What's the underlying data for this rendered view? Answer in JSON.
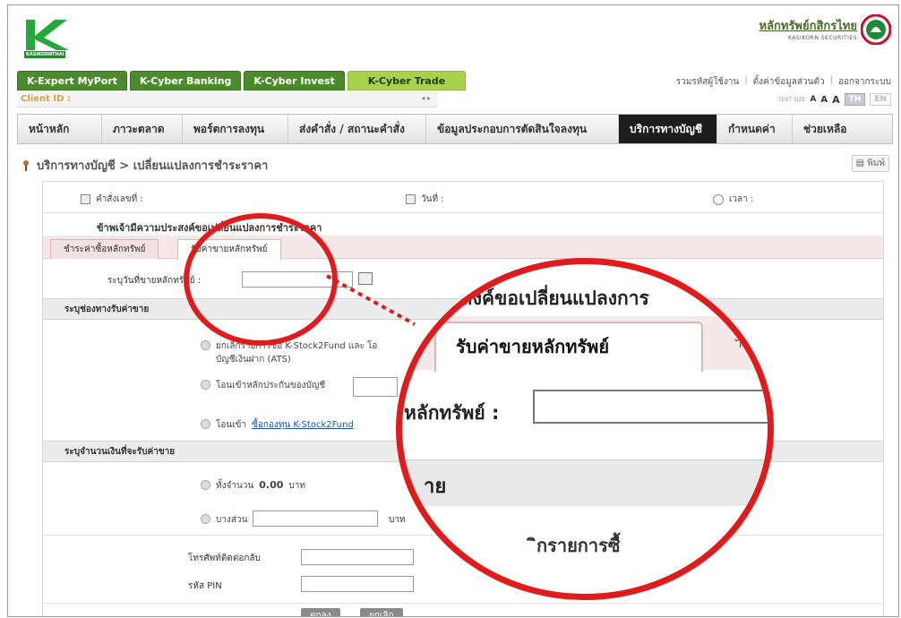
{
  "header": {
    "logo_text": "KASIKORNTHAI",
    "brand_main": "หลักทรัพย์กสิกรไทย",
    "brand_sub": "KASIKORN SECURITIES"
  },
  "top_tabs": [
    "K-Expert MyPort",
    "K-Cyber Banking",
    "K-Cyber Invest",
    "K-Cyber Trade"
  ],
  "user_links": [
    "รวมรหัสผู้ใช้งาน",
    "ตั้งค่าข้อมูลส่วนตัว",
    "ออกจากระบบ"
  ],
  "client": {
    "label": "Client ID :",
    "arrows": "◂ ▸"
  },
  "text_size": {
    "label": "TEXT SIZE",
    "a1": "A",
    "a2": "A",
    "a3": "A",
    "lang_th": "TH",
    "lang_en": "EN"
  },
  "main_nav": [
    "หน้าหลัก",
    "ภาวะตลาด",
    "พอร์ตการลงทุน",
    "ส่งคำสั่ง / สถานะคำสั่ง",
    "ข้อมูลประกอบการตัดสินใจลงทุน",
    "บริการทางบัญชี",
    "กำหนดค่า",
    "ช่วยเหลือ"
  ],
  "breadcrumb": "บริการทางบัญชี > เปลี่ยนแปลงการชำระราคา",
  "print_label": "พิมพ์",
  "form": {
    "order_no_label": "คำสั่งเลขที่ :",
    "date_label": "วันที่ :",
    "time_label": "เวลา :",
    "intent": "ข้าพเจ้ามีความประสงค์ขอเปลี่ยนแปลงการชำระราคา",
    "tab_buy": "ชำระค่าซื้อหลักทรัพย์",
    "tab_sell": "รับค่าขายหลักทรัพย์",
    "sell_date_label": "ระบุวันที่ขายหลักทรัพย์ :",
    "section_channel": "ระบุช่องทางรับค่าขาย",
    "option1_line1": "ยกเลิกรายการซื้อ K-Stock2Fund และ โอ",
    "option1_line2": "บัญชีเงินฝาก (ATS)",
    "option1_tail": "ัก",
    "option2": "โอนเข้าหลักประกันของบัญชี",
    "option3_prefix": "โอนเข้า",
    "option3_link": "ซื้อกองทุน K-Stock2Fund",
    "section_amount": "ระบุจำนวนเงินที่จะรับค่าขาย",
    "amount_full": "ทั้งจำนวน",
    "amount_value": "0.00",
    "baht": "บาท",
    "amount_partial": "บางส่วน",
    "phone_label": "โทรศัพท์ติดต่อกลับ",
    "pin_label": "รหัส PIN",
    "ok": "ตกลง",
    "cancel": "ยกเลิก"
  },
  "zoom": {
    "intent": "ประสงค์ขอเปลี่ยนแปลงการ",
    "tab_label": "รับค่าขายหลักทรัพย์",
    "after_tab": "ัก",
    "field_label": "หลักทรัพย์ :",
    "section": "าย",
    "below": "ิกรายการซื้"
  },
  "colors": {
    "accent_red": "#e01b1b",
    "nav_green": "#4b8b2c",
    "active_green": "#a9d24c"
  }
}
